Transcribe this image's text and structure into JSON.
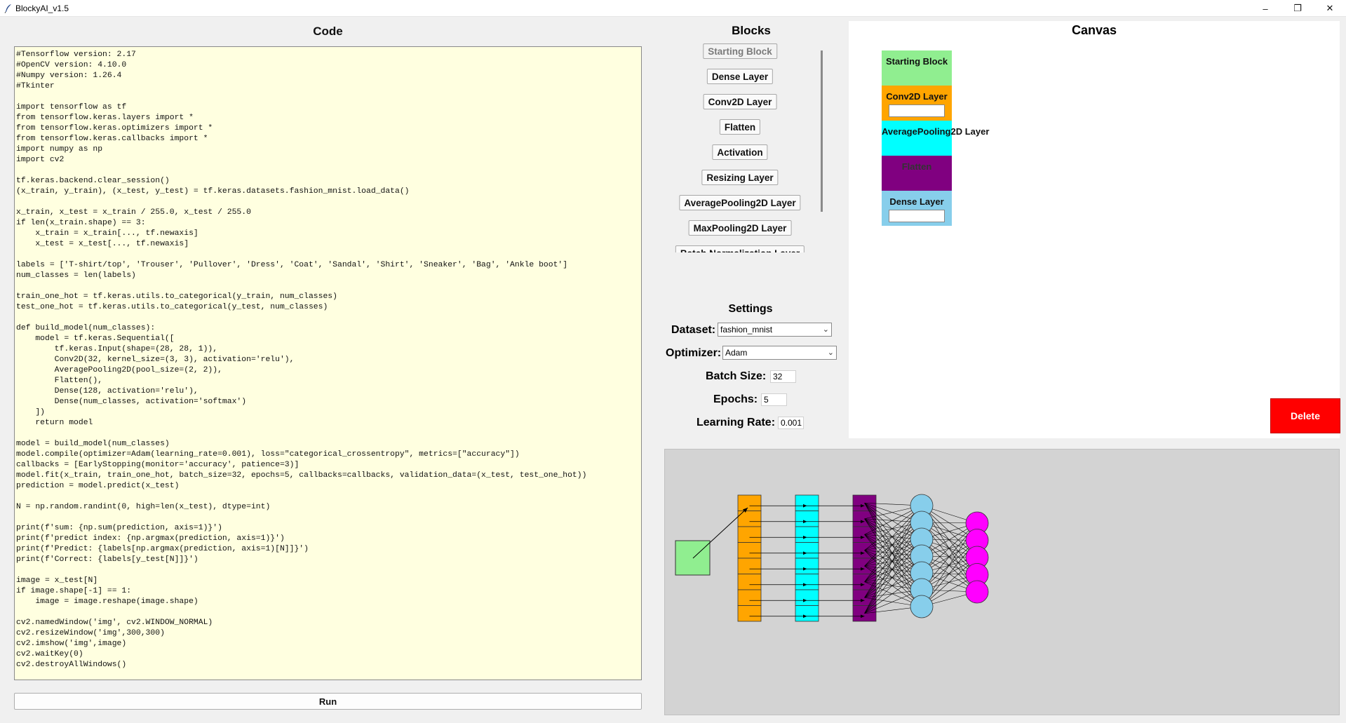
{
  "window": {
    "title": "BlockyAI_v1.5",
    "controls": [
      "–",
      "❐",
      "✕"
    ]
  },
  "code": {
    "header": "Code",
    "text": "#Tensorflow version: 2.17\n#OpenCV version: 4.10.0\n#Numpy version: 1.26.4\n#Tkinter\n\nimport tensorflow as tf\nfrom tensorflow.keras.layers import *\nfrom tensorflow.keras.optimizers import *\nfrom tensorflow.keras.callbacks import *\nimport numpy as np\nimport cv2\n\ntf.keras.backend.clear_session()\n(x_train, y_train), (x_test, y_test) = tf.keras.datasets.fashion_mnist.load_data()\n\nx_train, x_test = x_train / 255.0, x_test / 255.0\nif len(x_train.shape) == 3:\n    x_train = x_train[..., tf.newaxis]\n    x_test = x_test[..., tf.newaxis]\n\nlabels = ['T-shirt/top', 'Trouser', 'Pullover', 'Dress', 'Coat', 'Sandal', 'Shirt', 'Sneaker', 'Bag', 'Ankle boot']\nnum_classes = len(labels)\n\ntrain_one_hot = tf.keras.utils.to_categorical(y_train, num_classes)\ntest_one_hot = tf.keras.utils.to_categorical(y_test, num_classes)\n\ndef build_model(num_classes):\n    model = tf.keras.Sequential([\n        tf.keras.Input(shape=(28, 28, 1)),\n        Conv2D(32, kernel_size=(3, 3), activation='relu'),\n        AveragePooling2D(pool_size=(2, 2)),\n        Flatten(),\n        Dense(128, activation='relu'),\n        Dense(num_classes, activation='softmax')\n    ])\n    return model\n\nmodel = build_model(num_classes)\nmodel.compile(optimizer=Adam(learning_rate=0.001), loss=\"categorical_crossentropy\", metrics=[\"accuracy\"])\ncallbacks = [EarlyStopping(monitor='accuracy', patience=3)]\nmodel.fit(x_train, train_one_hot, batch_size=32, epochs=5, callbacks=callbacks, validation_data=(x_test, test_one_hot))\nprediction = model.predict(x_test)\n\nN = np.random.randint(0, high=len(x_test), dtype=int)\n\nprint(f'sum: {np.sum(prediction, axis=1)}')\nprint(f'predict index: {np.argmax(prediction, axis=1)}')\nprint(f'Predict: {labels[np.argmax(prediction, axis=1)[N]]}')\nprint(f'Correct: {labels[y_test[N]]}')\n\nimage = x_test[N]\nif image.shape[-1] == 1:\n    image = image.reshape(image.shape)\n\ncv2.namedWindow('img', cv2.WINDOW_NORMAL)\ncv2.resizeWindow('img',300,300)\ncv2.imshow('img',image)\ncv2.waitKey(0)\ncv2.destroyAllWindows()",
    "run_label": "Run"
  },
  "blocks": {
    "header": "Blocks",
    "items": [
      {
        "label": "Starting Block",
        "disabled": true
      },
      {
        "label": "Dense Layer",
        "disabled": false
      },
      {
        "label": "Conv2D Layer",
        "disabled": false
      },
      {
        "label": "Flatten",
        "disabled": false
      },
      {
        "label": "Activation",
        "disabled": false
      },
      {
        "label": "Resizing Layer",
        "disabled": false
      },
      {
        "label": "AveragePooling2D Layer",
        "disabled": false
      },
      {
        "label": "MaxPooling2D Layer",
        "disabled": false
      },
      {
        "label": "Batch Normalization Layer",
        "disabled": false
      }
    ]
  },
  "settings": {
    "title": "Settings",
    "dataset_label": "Dataset:",
    "dataset_value": "fashion_mnist",
    "optimizer_label": "Optimizer:",
    "optimizer_value": "Adam",
    "batch_size_label": "Batch Size:",
    "batch_size_value": "32",
    "epochs_label": "Epochs:",
    "epochs_value": "5",
    "learning_rate_label": "Learning Rate:",
    "learning_rate_value": "0.001"
  },
  "canvas": {
    "title": "Canvas",
    "blocks": [
      {
        "label": "Starting Block",
        "color": "#90ee90",
        "has_input": false
      },
      {
        "label": "Conv2D Layer",
        "color": "#ffa500",
        "has_input": true
      },
      {
        "label": "AveragePooling2D Layer",
        "color": "#00ffff",
        "has_input": false
      },
      {
        "label": "Flatten",
        "color": "#800080",
        "has_input": false
      },
      {
        "label": "Dense Layer",
        "color": "#87ceeb",
        "has_input": true
      }
    ],
    "delete_label": "Delete"
  },
  "visualization": {
    "colors": {
      "input": "#90ee90",
      "conv": "#ffa500",
      "pool": "#00ffff",
      "flatten": "#800080",
      "dense": "#87ceeb",
      "output": "#ff00ff",
      "background": "#d3d3d3"
    },
    "layers": [
      {
        "kind": "input",
        "units": 1
      },
      {
        "kind": "conv",
        "units": 8
      },
      {
        "kind": "pool",
        "units": 8
      },
      {
        "kind": "flatten",
        "units": 8
      },
      {
        "kind": "dense",
        "units": 7
      },
      {
        "kind": "output",
        "units": 5
      }
    ]
  }
}
